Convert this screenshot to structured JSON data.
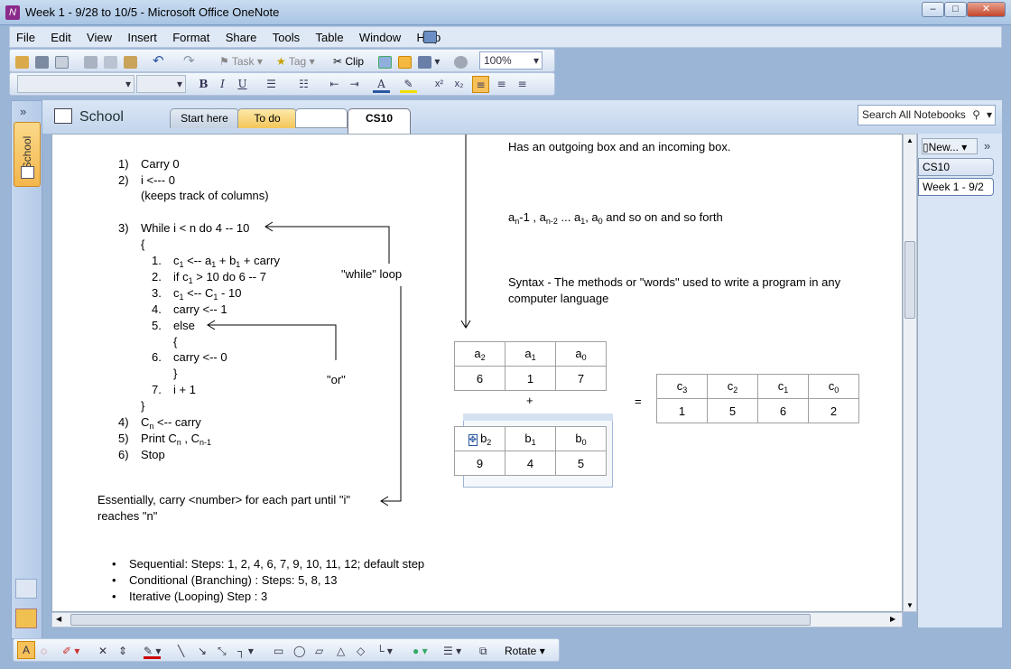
{
  "window": {
    "title": "Week 1 - 9/28 to 10/5 - Microsoft Office OneNote",
    "app_icon": "N",
    "minimize": "–",
    "maximize": "□",
    "close": "✕"
  },
  "menu": [
    "File",
    "Edit",
    "View",
    "Insert",
    "Format",
    "Share",
    "Tools",
    "Table",
    "Window",
    "Help"
  ],
  "toolbar": {
    "task": "Task",
    "tag": "Tag",
    "clip": "Clip",
    "zoom": "100%"
  },
  "format_toolbar": {
    "bold": "B",
    "italic": "I",
    "underline": "U",
    "font_color_letter": "A",
    "superscript": "x²",
    "subscript": "x₂"
  },
  "notebook": {
    "name": "School",
    "sidebar_label": "School"
  },
  "section_tabs": [
    "Start here",
    "To do",
    "",
    "CS10"
  ],
  "search": {
    "placeholder": "Search All Notebooks"
  },
  "pages": {
    "new_label": "New...",
    "items": [
      "CS10",
      "Week 1 - 9/2"
    ]
  },
  "note": {
    "steps": [
      {
        "num": "1)",
        "text": "Carry  0"
      },
      {
        "num": "2)",
        "text": "i  <--- 0"
      },
      {
        "num": "",
        "text": "(keeps track of  columns)"
      },
      {
        "num": "3)",
        "text": "While i < n do 4 -- 10"
      },
      {
        "num": "",
        "text": "{"
      }
    ],
    "sub_steps": [
      {
        "num": "1.",
        "a": "c",
        "as": "1",
        "b": " <-- a",
        "bs": "1",
        "c": " + b",
        "cs": "1",
        "d": " + carry"
      },
      {
        "num": "2.",
        "a": "if c",
        "as": "1",
        "b": " > 10 do 6 -- 7",
        "bs": "",
        "c": "",
        "cs": "",
        "d": ""
      },
      {
        "num": "3.",
        "a": " c",
        "as": "1",
        "b": " <-- C",
        "bs": "1",
        "c": " - 10",
        "cs": "",
        "d": ""
      },
      {
        "num": "4.",
        "a": "carry <-- 1",
        "as": "",
        "b": "",
        "bs": "",
        "c": "",
        "cs": "",
        "d": ""
      },
      {
        "num": "5.",
        "a": "else",
        "as": "",
        "b": "",
        "bs": "",
        "c": "",
        "cs": "",
        "d": ""
      },
      {
        "num": "",
        "a": "{",
        "as": "",
        "b": "",
        "bs": "",
        "c": "",
        "cs": "",
        "d": ""
      },
      {
        "num": "6.",
        "a": "carry <-- 0",
        "as": "",
        "b": "",
        "bs": "",
        "c": "",
        "cs": "",
        "d": ""
      },
      {
        "num": "",
        "a": "}",
        "as": "",
        "b": "",
        "bs": "",
        "c": "",
        "cs": "",
        "d": ""
      },
      {
        "num": "7.",
        "a": "i + 1",
        "as": "",
        "b": "",
        "bs": "",
        "c": "",
        "cs": "",
        "d": ""
      }
    ],
    "close_brace": "}",
    "tail_steps": [
      {
        "num": "4)",
        "text": "C",
        "sub": "n",
        "rest": "  <-- carry",
        "sub2": ""
      },
      {
        "num": "5)",
        "text": "Print C",
        "sub": "n",
        "rest": " , C",
        "sub2": "n-1"
      },
      {
        "num": "6)",
        "text": "Stop",
        "sub": "",
        "rest": "",
        "sub2": ""
      }
    ],
    "while_label": "\"while\" loop",
    "or_label": "\"or\"",
    "essentially_1": "Essentially,  carry <number> for each part  until \"i\"",
    "essentially_2": "reaches \"n\"",
    "bullets": [
      "Sequential: Steps:  1, 2, 4, 6, 7, 9, 10, 11, 12; default step",
      "Conditional (Branching) :  Steps: 5, 8, 13",
      "Iterative (Looping) Step : 3"
    ],
    "right_1": "Has an outgoing box and an incoming box.",
    "seq_text": {
      "a": "a",
      "a_sub": "n",
      "a_rest": "-1 ,  a",
      "b_sub": "n-2",
      "b_rest": " ... a",
      "c_sub": "1",
      "c_rest": ", a",
      "d_sub": "0",
      "tail": " and so on and so forth"
    },
    "syntax_1": "Syntax - The methods or \"words\" used to write a program in any",
    "syntax_2": "computer language",
    "table_a": {
      "headers": [
        [
          "a",
          "2"
        ],
        [
          "a",
          "1"
        ],
        [
          "a",
          "0"
        ]
      ],
      "values": [
        "6",
        "1",
        "7"
      ]
    },
    "plus": "+",
    "equals": "=",
    "table_b": {
      "headers": [
        [
          "b",
          "2"
        ],
        [
          "b",
          "1"
        ],
        [
          "b",
          "0"
        ]
      ],
      "values": [
        "9",
        "4",
        "5"
      ]
    },
    "table_c": {
      "headers": [
        [
          "c",
          "3"
        ],
        [
          "c",
          "2"
        ],
        [
          "c",
          "1"
        ],
        [
          "c",
          "0"
        ]
      ],
      "values": [
        "1",
        "5",
        "6",
        "2"
      ]
    }
  },
  "draw_toolbar": {
    "rotate": "Rotate"
  }
}
